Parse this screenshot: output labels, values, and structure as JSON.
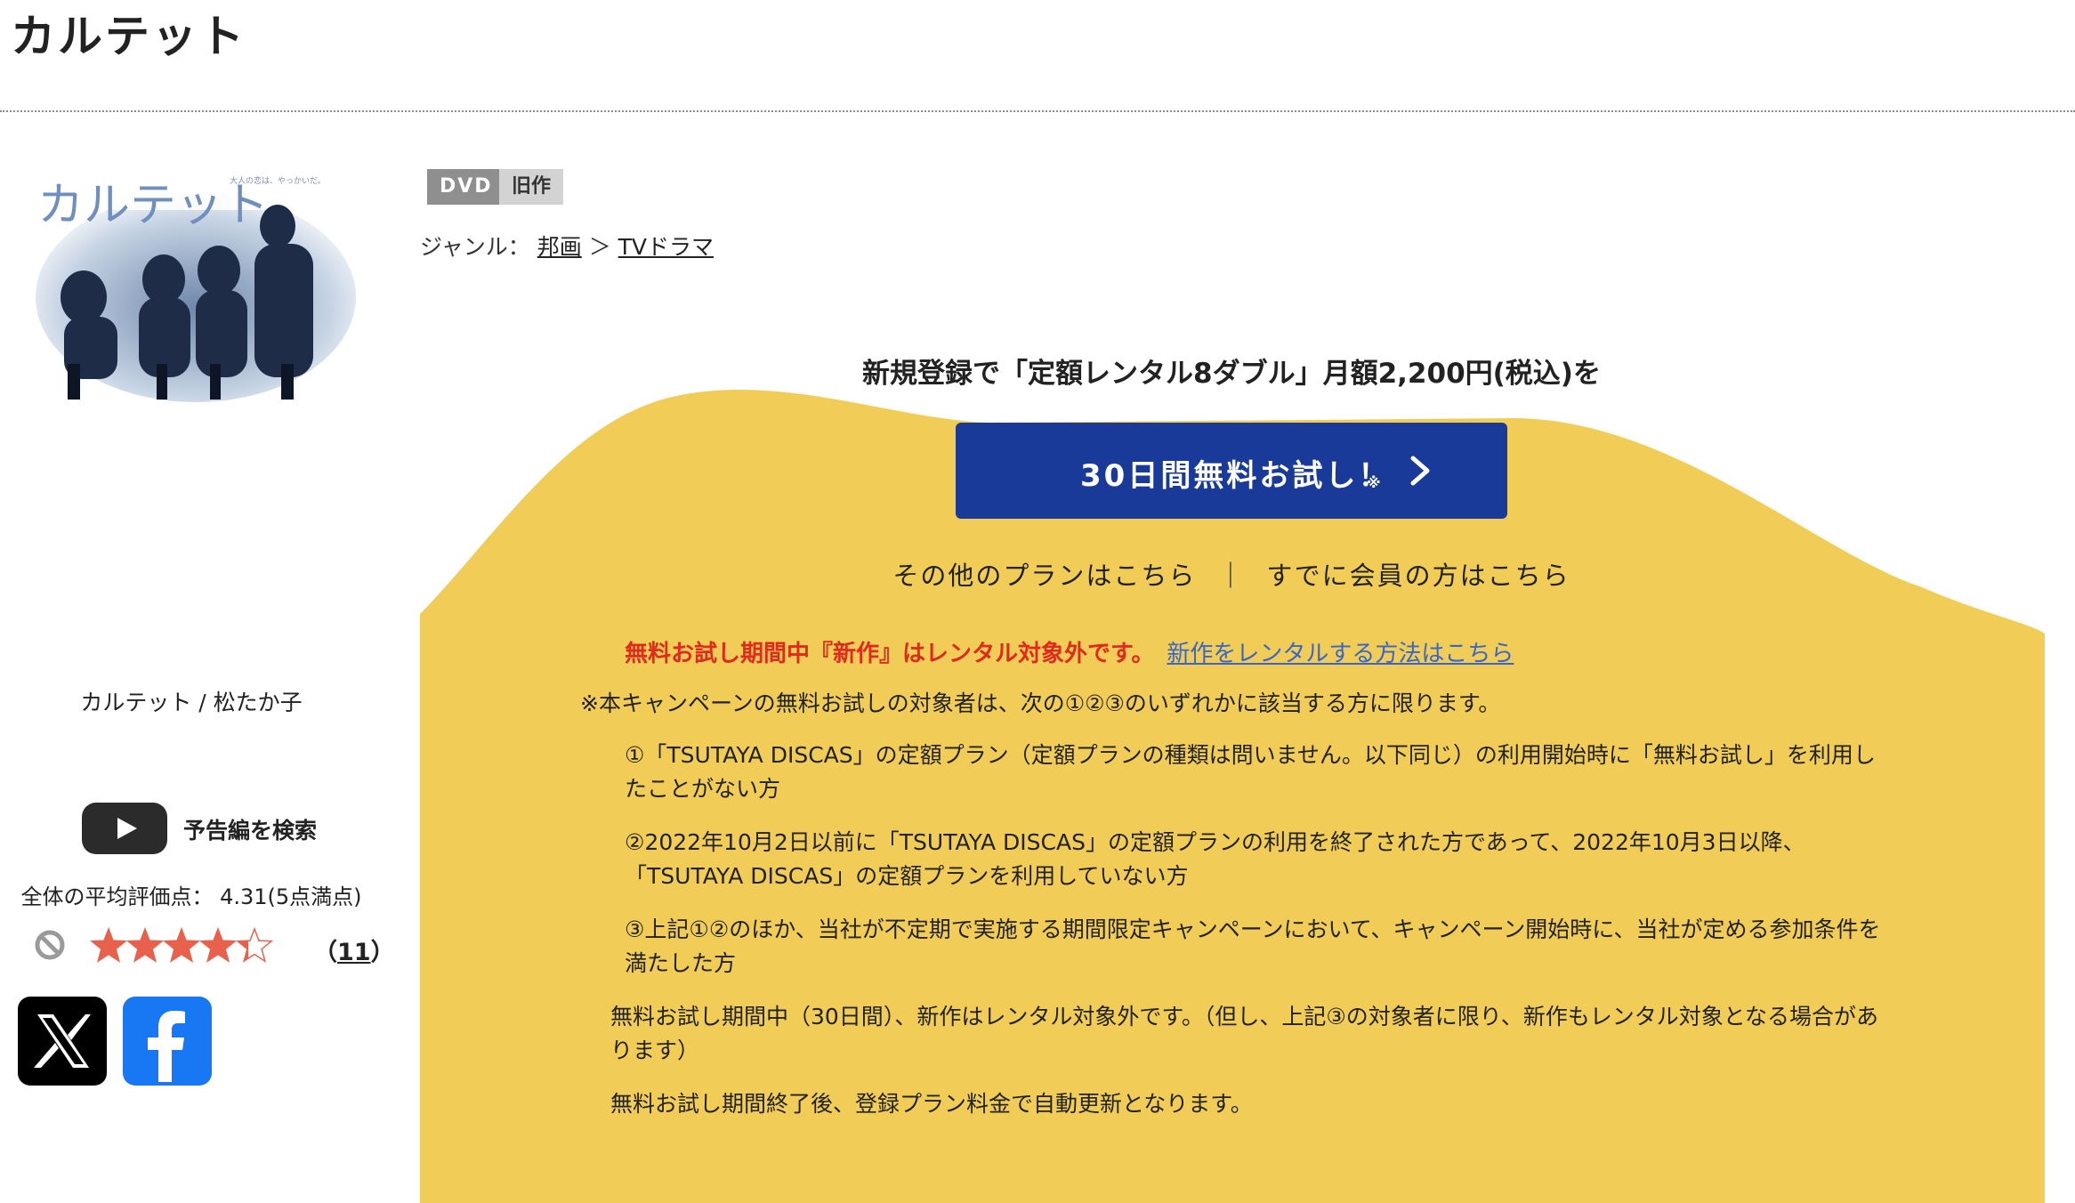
{
  "title": "カルテット",
  "cover": {
    "title_art": "カルテット",
    "tagline": "大人の恋は、やっかいだ。"
  },
  "tags": {
    "format": "DVD",
    "age": "旧作"
  },
  "genre": {
    "label": "ジャンル：",
    "primary": "邦画",
    "separator": "＞",
    "secondary": "TVドラマ"
  },
  "product_name": "カルテット / 松たか子",
  "trailer": {
    "label": "予告編を検索",
    "icon": "youtube-play-icon"
  },
  "rating": {
    "average_text": "全体の平均評価点： 4.31(5点満点)",
    "value": 4.31,
    "max": 5,
    "review_count_open": "（",
    "review_count": "11",
    "review_count_close": "）"
  },
  "share": {
    "x_icon": "x-logo-icon",
    "facebook_icon": "facebook-logo-icon"
  },
  "campaign": {
    "heading": "新規登録で「定額レンタル8ダブル」月額2,200円(税込)を",
    "trial_button": "30日間無料お試し！",
    "trial_button_mark": "※",
    "other_plans": "その他のプランはこちら",
    "link_separator": "｜",
    "members": "すでに会員の方はこちら",
    "warning": "無料お試し期間中『新作』はレンタル対象外です。",
    "warning_link": "新作をレンタルする方法はこちら",
    "intro": "※本キャンペーンの無料お試しの対象者は、次の①②③のいずれかに該当する方に限ります。",
    "conditions": [
      "①「TSUTAYA DISCAS」の定額プラン（定額プランの種類は問いません。以下同じ）の利用開始時に「無料お試し」を利用したことがない方",
      "②2022年10月2日以前に「TSUTAYA DISCAS」の定額プランの利用を終了された方であって、2022年10月3日以降、「TSUTAYA DISCAS」の定額プランを利用していない方",
      "③上記①②のほか、当社が不定期で実施する期間限定キャンペーンにおいて、キャンペーン開始時に、当社が定める参加条件を満たした方"
    ],
    "free_note": "無料お試し期間中（30日間）、新作はレンタル対象外です。（但し、上記③の対象者に限り、新作もレンタル対象となる場合があります）",
    "renew_note": "無料お試し期間終了後、登録プラン料金で自動更新となります。"
  },
  "colors": {
    "accent_yellow": "#f1cd58",
    "button_blue": "#1a3a9a",
    "warning_red": "#e02a1e",
    "link_blue": "#3a66c8",
    "star": "#e8614c"
  }
}
